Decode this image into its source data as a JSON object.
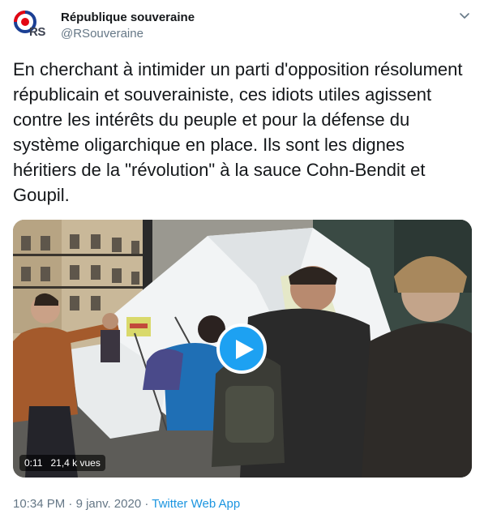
{
  "user": {
    "display_name": "République souveraine",
    "handle": "@RSouveraine",
    "avatar_text": "RS",
    "avatar_colors": {
      "red": "#e30613",
      "blue": "#1b3f94",
      "text": "#3b4150"
    }
  },
  "tweet": {
    "text": "En cherchant à intimider un parti d'opposition résolument républicain et souverainiste, ces idiots utiles agissent contre les intérêts du peuple et pour la défense du système oligarchique en place. Ils sont les dignes héritiers de la \"révolution\" à la sauce Cohn-Bendit et Goupil."
  },
  "video": {
    "duration": "0:11",
    "views": "21,4 k vues",
    "play_icon": "play-icon",
    "accent_color": "#1da1f2"
  },
  "footer": {
    "time": "10:34 PM",
    "separator1": " · ",
    "date": "9 janv. 2020",
    "separator2": " · ",
    "app": "Twitter Web App"
  },
  "icons": {
    "menu": "chevron-down-icon"
  }
}
